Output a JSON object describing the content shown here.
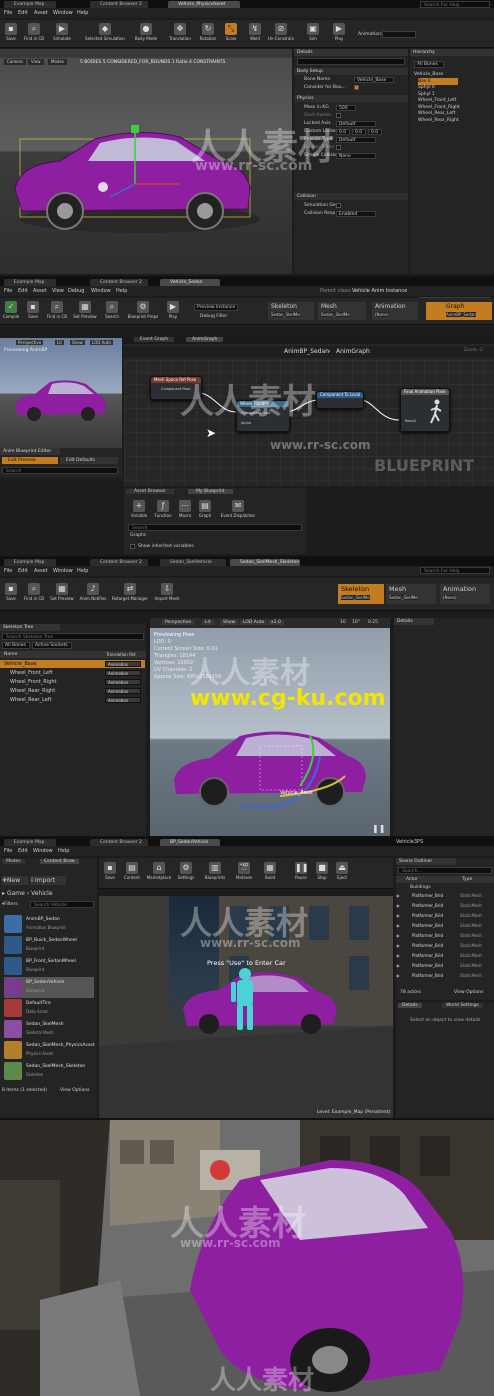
{
  "editor_common": {
    "menus": [
      "File",
      "Edit",
      "Asset",
      "Window",
      "Help"
    ],
    "search_placeholder": "Search For Help"
  },
  "physics_editor": {
    "tabs": [
      "Example Map",
      "Content Browser 2",
      "Vehicle_PhysicsAsset"
    ],
    "toolbar": [
      "Save",
      "Find in CB",
      "Simulate",
      "Selected Simulation",
      "Body Mode",
      "Translation",
      "Rotation",
      "Scale",
      "Weld",
      "Un-Constrain",
      "Sim",
      "Play",
      "Animation:"
    ],
    "viewport_info": "5 BODIES   5 CONSIDERED_FOR_BOUNDS   1 Ratio   4 CONSTRAINTS",
    "viewport_buttons": [
      "Camera",
      "View",
      "Modes"
    ],
    "details_title": "Details",
    "sections": {
      "body_setup": "Body Setup",
      "physics": "Physics",
      "collision": "Collision"
    },
    "props": [
      {
        "label": "Bone Name",
        "value": "Vehicle_Base"
      },
      {
        "label": "Consider for Bou...",
        "value": ""
      },
      {
        "label": "Mass in KG",
        "value": "500"
      },
      {
        "label": "Start Awake",
        "value": ""
      },
      {
        "label": "Locked Axis",
        "value": "Default"
      },
      {
        "label": "Custom Locke",
        "value": "0.0"
      },
      {
        "label": "Physics Type",
        "value": "Default"
      },
      {
        "label": "Double Sided",
        "value": ""
      },
      {
        "label": "Simple Collisio",
        "value": "None"
      }
    ],
    "collision_props": [
      {
        "label": "Simulation Ge",
        "value": ""
      },
      {
        "label": "Collision Resp",
        "value": "Enabled"
      }
    ],
    "hierarchy_title": "Hierarchy",
    "hierarchy_filter": "All Bones",
    "hierarchy": [
      "Vehicle_Base",
      "Box 0",
      "Sphyl 0",
      "Sphyl 1",
      "Wheel_Front_Left",
      "Wheel_Front_Right",
      "Wheel_Rear_Left",
      "Wheel_Rear_Right"
    ]
  },
  "anim_blueprint": {
    "tabs": [
      "Example Map",
      "Content Browser 2",
      "Vehicle_Sedan"
    ],
    "menus": [
      "File",
      "Edit",
      "Asset",
      "View",
      "Debug",
      "Window",
      "Help"
    ],
    "parent_class": "Parent class:",
    "parent_class_value": "Vehicle Anim Instance",
    "toolbar": [
      "Compile",
      "Save",
      "Find in CB",
      "Set Preview",
      "Search",
      "Blueprint Props",
      "Play"
    ],
    "preview_instance": "Preview Instance",
    "debug_filter": "Debug Filter",
    "modes": [
      {
        "title": "Skeleton",
        "value": "Sedan_SkelMe"
      },
      {
        "title": "Mesh",
        "value": "Sedan_SkelMe"
      },
      {
        "title": "Animation",
        "value": "(None)"
      },
      {
        "title": "Graph",
        "value": "AnimBP_Sedan"
      }
    ],
    "preview_title": "Previewing AnimBP",
    "viewport_buttons": [
      "Perspective",
      "Lit",
      "Show",
      "LOD Auto"
    ],
    "graph_tabs": [
      "Event Graph",
      "AnimGraph"
    ],
    "breadcrumb_root": "AnimBP_Sedan",
    "breadcrumb_leaf": "AnimGraph",
    "zoom": "Zoom -2",
    "nodes": [
      "Mesh Space Ref Pose",
      "Wheel Handler",
      "Component To Local",
      "Final Animation Pose"
    ],
    "pins": [
      "Component Pose",
      "Alpha",
      "Result"
    ],
    "blueprint_watermark": "BLUEPRINT",
    "defaults_title": "Anim Blueprint Editor",
    "defaults_buttons": [
      "Edit Preview",
      "Edit Defaults"
    ],
    "search": "Search",
    "palette_tabs": [
      "Asset Browser",
      "My Blueprint"
    ],
    "palette_buttons": [
      "Variable",
      "Function",
      "Macro",
      "Graph",
      "Event Dispatcher"
    ],
    "palette_search": "Search",
    "palette_section": "Graphs",
    "show_inherited": "Show inherited variables"
  },
  "persona": {
    "tabs": [
      "Example Map",
      "Content Browser 2",
      "Sedan_SkelVehicle"
    ],
    "title_tab": "Sedan_SkelMesh_Skeleton",
    "menus": [
      "File",
      "Edit",
      "Asset",
      "Window",
      "Help"
    ],
    "toolbar": [
      "Save",
      "Find in CB",
      "Set Preview",
      "Anim Notifies",
      "Retarget Manager",
      "Import Mesh"
    ],
    "modes": [
      {
        "title": "Skeleton",
        "value": "Sedan_SkelMe"
      },
      {
        "title": "Mesh",
        "value": "Sedan_SkelMe"
      },
      {
        "title": "Animation",
        "value": "(None)"
      }
    ],
    "tree_title": "Skeleton Tree",
    "tree_search": "Search Skeleton Tree",
    "tree_filters": [
      "All Bones",
      "Active Sockets"
    ],
    "col_name": "Name",
    "col_translation": "Translation Ret",
    "bones": [
      "Vehicle_Base",
      "Wheel_Front_Left",
      "Wheel_Front_Right",
      "Wheel_Rear_Right",
      "Wheel_Rear_Left"
    ],
    "bone_mode": "Animation",
    "viewport_buttons": [
      "Perspective",
      "Lit",
      "Show",
      "LOD Auto",
      "x1.0"
    ],
    "snap_values": [
      "10",
      "10°",
      "0.25"
    ],
    "preview_lines": [
      "Previewing Pose",
      "LOD: 0",
      "Current Screen Size: 0.61",
      "Triangles: 18144",
      "Vertices: 10002",
      "UV Channels: 2",
      "Approx Size: 486x218x156"
    ],
    "bone_label": "Vehicle_Base",
    "details_title": "Details",
    "watermark": "www.cg-ku.com"
  },
  "level_editor": {
    "tabs": [
      "Example Map",
      "Content Browser 2",
      "BP_SedanVehicle"
    ],
    "title_right": "Vehicle3PS",
    "menus": [
      "File",
      "Edit",
      "Window",
      "Help"
    ],
    "modes_tab": "Modes",
    "content_tab": "Content Brow",
    "new_label": "New",
    "import_label": "Import",
    "breadcrumb": [
      "Game",
      "Vehicle"
    ],
    "filters_label": "Filters",
    "search_placeholder": "Search Vehicle",
    "assets": [
      {
        "name": "AnimBP_Sedan",
        "type": "Animation Blueprint",
        "color": "#3a6ea5"
      },
      {
        "name": "BP_Buick_SedanWheel",
        "type": "Blueprint",
        "color": "#2e5a8a"
      },
      {
        "name": "BP_Front_SedanWheel",
        "type": "Blueprint",
        "color": "#2e5a8a"
      },
      {
        "name": "BP_SedanVehicle",
        "type": "Blueprint",
        "color": "#7a3b8f"
      },
      {
        "name": "DefaultTire",
        "type": "Data Asset",
        "color": "#a33b3b"
      },
      {
        "name": "Sedan_SkelMesh",
        "type": "Skeletal Mesh",
        "color": "#8a4fa0"
      },
      {
        "name": "Sedan_SkelMesh_PhysicsAsset",
        "type": "Physics Asset",
        "color": "#b0802a"
      },
      {
        "name": "Sedan_SkelMesh_Skeleton",
        "type": "Skeleton",
        "color": "#5d8a4a"
      }
    ],
    "assets_count": "8 items (1 selected)",
    "view_options": "View Options",
    "toolbar": [
      "Save",
      "Content",
      "Marketplace",
      "Settings",
      "Blueprints",
      "Matinee",
      "Build",
      "Pause",
      "Stop",
      "Eject"
    ],
    "outliner_title": "Scene Outliner",
    "outliner_search": "Search...",
    "outliner_cols": [
      "Actor",
      "Type"
    ],
    "outliner_group": "Buildings",
    "outliner_rows": [
      {
        "name": "Platformer_Brid",
        "type": "StaticMesh"
      },
      {
        "name": "Platformer_Brid",
        "type": "StaticMesh"
      },
      {
        "name": "Platformer_Brid",
        "type": "StaticMesh"
      },
      {
        "name": "Platformer_Brid",
        "type": "StaticMesh"
      },
      {
        "name": "Platformer_Brid",
        "type": "StaticMesh"
      },
      {
        "name": "Platformer_Brid",
        "type": "StaticMesh"
      },
      {
        "name": "Platformer_Brid",
        "type": "StaticMesh"
      },
      {
        "name": "Platformer_Brid",
        "type": "StaticMesh"
      },
      {
        "name": "Platformer_Brid",
        "type": "StaticMesh"
      }
    ],
    "actor_count": "78 actors",
    "outliner_view_options": "View Options",
    "details_tabs": [
      "Details",
      "World Settings"
    ],
    "details_empty": "Select an object to view details",
    "viewport_prompt": "Press \"Use\" to Enter Car",
    "level_label": "Level:  Example_Map (Persistent)"
  },
  "game_view": {
    "watermark": "人人素材"
  },
  "watermarks": {
    "cn": "人人素材",
    "url": "www.rr-sc.com"
  },
  "colors": {
    "accent": "#c47c20",
    "car": "#8e1fa0",
    "select": "#c47c20"
  }
}
